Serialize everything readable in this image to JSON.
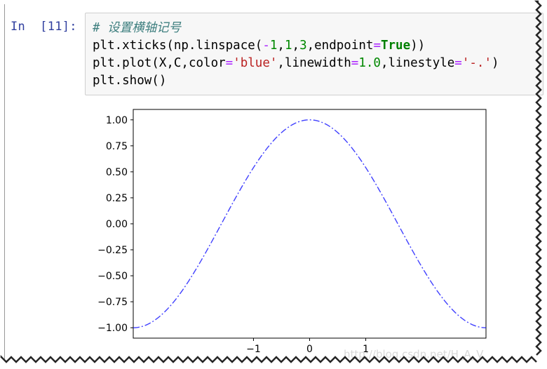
{
  "cell": {
    "prompt_in": "In",
    "prompt_num": "[11]:",
    "comment": "# 设置横轴记号",
    "line1_a": "plt.xticks(np.linspace(",
    "line1_minus": "-",
    "line1_n1": "1",
    "line1_sep1": ",",
    "line1_n2": "1",
    "line1_sep2": ",",
    "line1_n3": "3",
    "line1_sep3": ",endpoint",
    "line1_eq": "=",
    "line1_true": "True",
    "line1_end": "))",
    "line2_a": "plt.plot(X,C,color",
    "line2_eq1": "=",
    "line2_str1": "'blue'",
    "line2_b": ",linewidth",
    "line2_eq2": "=",
    "line2_num": "1.0",
    "line2_c": ",linestyle",
    "line2_eq3": "=",
    "line2_str2": "'-.'",
    "line2_end": ")",
    "line3": "plt.show()"
  },
  "watermark": "http://blog.csdn.net/H_A_V",
  "chart_data": {
    "type": "line",
    "title": "",
    "xlabel": "",
    "ylabel": "",
    "xlim": [
      -3.14159,
      3.14159
    ],
    "ylim": [
      -1.1,
      1.1
    ],
    "xticks": [
      -1,
      0,
      1
    ],
    "xtick_labels": [
      "−1",
      "0",
      "1"
    ],
    "yticks": [
      1.0,
      0.75,
      0.5,
      0.25,
      0.0,
      -0.25,
      -0.5,
      -0.75,
      -1.0
    ],
    "ytick_labels": [
      "1.00",
      "0.75",
      "0.50",
      "0.25",
      "0.00",
      "−0.25",
      "−0.50",
      "−0.75",
      "−1.00"
    ],
    "series": [
      {
        "function": "cos(x)",
        "x_range": [
          -3.14159,
          3.14159
        ],
        "color": "#0000ff",
        "linestyle": "-.",
        "linewidth": 1.0
      }
    ],
    "grid": false
  }
}
